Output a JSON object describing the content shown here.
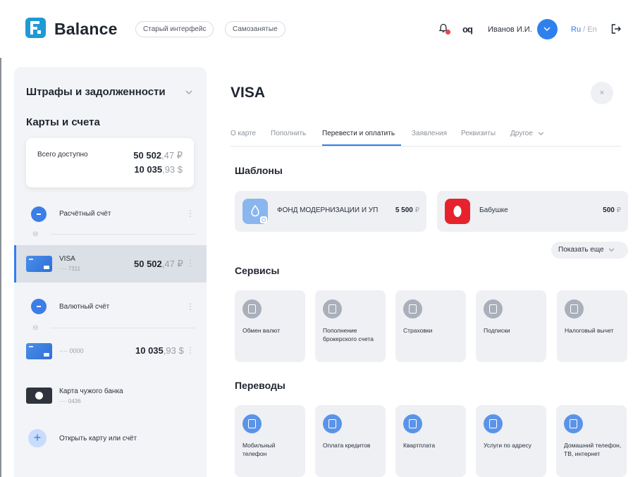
{
  "header": {
    "logo_text": "Balance",
    "old_ui_label": "Старый интерфейс",
    "self_employed_label": "Самозанятые",
    "user_name": "Иванов И.И.",
    "lang_ru": "Ru",
    "lang_sep": "/",
    "lang_en": "En",
    "glasses_glyph": "oq"
  },
  "sidebar": {
    "fines_title": "Штрафы и задолженности",
    "cards_title": "Карты и счета",
    "total": {
      "label": "Всего доступно",
      "rub_int": "50 502",
      "rub_dec": ",47 ₽",
      "usd_int": "10 035",
      "usd_dec": ",93 $"
    },
    "accounts": [
      {
        "name": "Расчётный счёт"
      },
      {
        "name": "Валютный счёт"
      }
    ],
    "cards": [
      {
        "name": "VISA",
        "number": "···· 7311",
        "amount_int": "50 502",
        "amount_dec": ",47 ₽"
      },
      {
        "name": "",
        "number": "···· 0000",
        "amount_int": "10 035",
        "amount_dec": ",93 $"
      }
    ],
    "foreign_card": {
      "name": "Карта чужого банка",
      "number": "···· 0436"
    },
    "open_card_label": "Открыть карту или счёт",
    "kebab_glyph": "⋮",
    "link_glyph": "⊖",
    "plus_glyph": "+"
  },
  "main": {
    "title": "VISA",
    "close_glyph": "×",
    "tabs": [
      "О карте",
      "Пополнить",
      "Перевести и оплатить",
      "Заявления",
      "Реквизиты",
      "Другое"
    ],
    "active_tab": 2,
    "templates_title": "Шаблоны",
    "templates": [
      {
        "name": "ФОНД МОДЕРНИЗАЦИИ И УП",
        "amount": "5 500",
        "currency": "₽"
      },
      {
        "name": "Бабушке",
        "amount": "500",
        "currency": "₽"
      }
    ],
    "show_more_label": "Показать еще",
    "services_title": "Сервисы",
    "services": [
      "Обмен валют",
      "Пополнение брокерского счета",
      "Страховки",
      "Подписки",
      "Налоговый вычет"
    ],
    "transfers_title": "Переводы",
    "transfers": [
      "Мобильный телефон",
      "Оплата кредитов",
      "Квартплата",
      "Услуги по адресу",
      "Домашний телефон, ТВ, интернет"
    ]
  },
  "colors": {
    "accent": "#2f80ed",
    "brand": "#1f9ad6",
    "alert": "#e8424b",
    "template_red": "#e6232d"
  }
}
